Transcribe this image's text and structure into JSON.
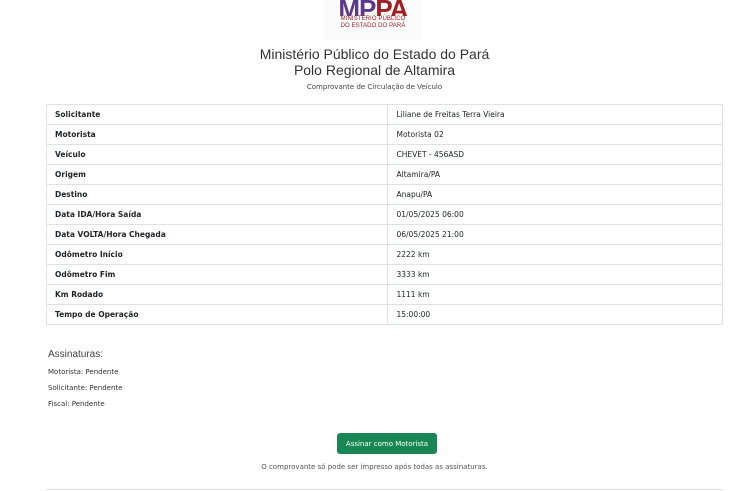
{
  "logo": {
    "mark_a": "MP",
    "mark_b": "PA",
    "line1": "MINISTÉRIO PÚBLICO",
    "line2": "DO ESTADO DO PARÁ"
  },
  "header": {
    "title": "Ministério Público do Estado do Pará",
    "subtitle": "Polo Regional de Altamira",
    "document": "Comprovante de Circulação de Veículo"
  },
  "rows": [
    {
      "label": "Solicitante",
      "value": "Liliane de Freitas Terra Vieira"
    },
    {
      "label": "Motorista",
      "value": "Motorista 02"
    },
    {
      "label": "Veículo",
      "value": "CHEVET - 456ASD"
    },
    {
      "label": "Origem",
      "value": "Altamira/PA"
    },
    {
      "label": "Destino",
      "value": "Anapu/PA"
    },
    {
      "label": "Data IDA/Hora Saída",
      "value": "01/05/2025 06:00"
    },
    {
      "label": "Data VOLTA/Hora Chegada",
      "value": "06/05/2025 21:00"
    },
    {
      "label": "Odômetro Início",
      "value": "2222 km"
    },
    {
      "label": "Odômetro Fim",
      "value": "3333 km"
    },
    {
      "label": "Km Rodado",
      "value": "1111 km"
    },
    {
      "label": "Tempo de Operação",
      "value": "15:00:00"
    }
  ],
  "signatures": {
    "title": "Assinaturas:",
    "items": [
      "Motorista: Pendente",
      "Solicitante: Pendente",
      "Fiscal: Pendente"
    ]
  },
  "actions": {
    "sign_label": "Assinar como Motorista",
    "note": "O comprovante só pode ser impresso após todas as assinaturas."
  },
  "colors": {
    "button": "#198754",
    "logo_red": "#a31d24"
  }
}
